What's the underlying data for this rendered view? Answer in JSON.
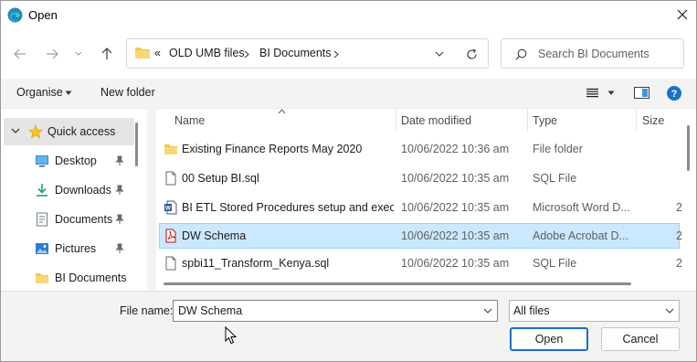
{
  "window": {
    "title": "Open"
  },
  "address": {
    "overflow": "«",
    "segments": [
      "OLD UMB files",
      "BI Documents"
    ]
  },
  "search": {
    "placeholder": "Search BI Documents"
  },
  "toolbar": {
    "organise_label": "Organise",
    "new_folder_label": "New folder"
  },
  "sidebar": {
    "items": [
      {
        "label": "Quick access",
        "icon": "star-icon"
      },
      {
        "label": "Desktop",
        "icon": "desktop-icon"
      },
      {
        "label": "Downloads",
        "icon": "download-icon"
      },
      {
        "label": "Documents",
        "icon": "documents-icon"
      },
      {
        "label": "Pictures",
        "icon": "pictures-icon"
      },
      {
        "label": "BI Documents",
        "icon": "folder-icon"
      }
    ]
  },
  "columns": {
    "name": "Name",
    "date": "Date modified",
    "type": "Type",
    "size": "Size"
  },
  "files": [
    {
      "name": "Existing Finance Reports May 2020",
      "date": "10/06/2022 10:36 am",
      "type": "File folder",
      "size": "",
      "icon": "folder-icon"
    },
    {
      "name": "00 Setup BI.sql",
      "date": "10/06/2022 10:35 am",
      "type": "SQL File",
      "size": "",
      "icon": "sql-file-icon"
    },
    {
      "name": "BI ETL Stored Procedures setup and exec...",
      "date": "10/06/2022 10:35 am",
      "type": "Microsoft Word D...",
      "size": "2",
      "icon": "word-file-icon"
    },
    {
      "name": "DW Schema",
      "date": "10/06/2022 10:35 am",
      "type": "Adobe Acrobat D...",
      "size": "2",
      "icon": "pdf-file-icon"
    },
    {
      "name": "spbi11_Transform_Kenya.sql",
      "date": "10/06/2022 10:35 am",
      "type": "SQL File",
      "size": "2",
      "icon": "sql-file-icon"
    }
  ],
  "bottom": {
    "file_name_label": "File name:",
    "file_name_value": "DW Schema",
    "filter_value": "All files",
    "open_label": "Open",
    "cancel_label": "Cancel"
  },
  "colors": {
    "accent": "#0078d4",
    "selection": "#cce8ff",
    "folder": "#f2c94c"
  }
}
